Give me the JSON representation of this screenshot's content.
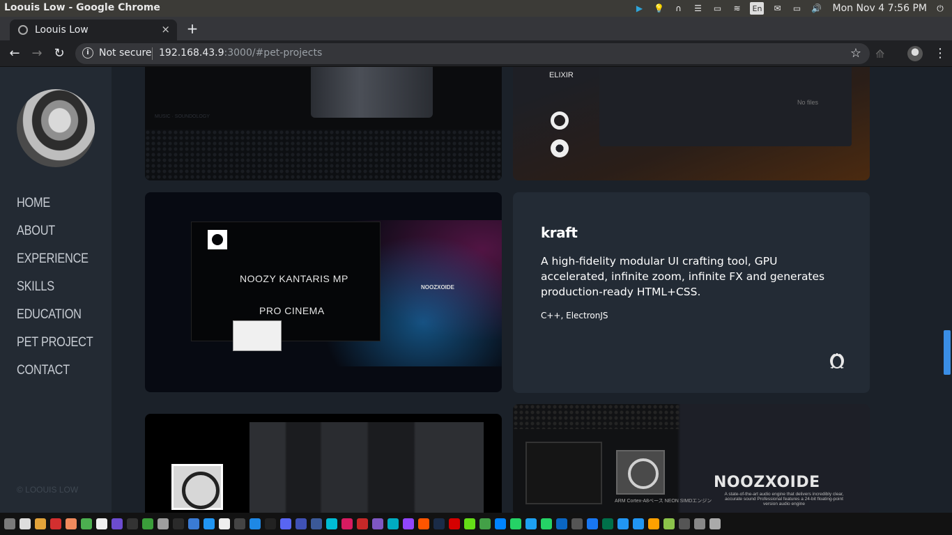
{
  "os": {
    "window_title": "Loouis Low - Google Chrome",
    "lang": "En",
    "clock": "Mon Nov  4  7:56 PM"
  },
  "browser": {
    "tab_title": "Loouis Low",
    "tab_close": "×",
    "new_tab": "+",
    "security": "Not secure",
    "url_host": "192.168.43.9",
    "url_path": ":3000/#pet-projects"
  },
  "sidebar": {
    "nav": [
      "HOME",
      "ABOUT",
      "EXPERIENCE",
      "SKILLS",
      "EDUCATION",
      "PET PROJECT",
      "CONTACT"
    ],
    "copyright": "© LOOUIS LOW"
  },
  "cards": {
    "music": {
      "caption": "MUSIC · SOUNDOLOGY"
    },
    "elixir": {
      "label": "ELIXIR",
      "status": "No files"
    },
    "noozy": {
      "title": "NOOZY KANTARIS MP",
      "subtitle": "PRO CINEMA",
      "brand": "NOOZXOIDE"
    },
    "kraft": {
      "title": "kraft",
      "description": "A high-fidelity modular UI crafting tool, GPU accelerated, infinite zoom, infinite FX and generates production-ready HTML+CSS.",
      "tech": "C++, ElectronJS",
      "platform_icon": "linux-tux-icon"
    },
    "noozxoide": {
      "brand": "NOOZXOIDE",
      "tagline": "A state-of-the-art audio engine that delivers incredibly clear, accurate sound Professional features a 24-bit floating-point version audio engine",
      "chip_label": "ARM Cortex-A8ベース NEON SIMDエンジン"
    }
  },
  "dock": {
    "icons": [
      "#7a7a7a",
      "#ddd",
      "#e2a33a",
      "#d32f2f",
      "#f08a5d",
      "#4caf50",
      "#eee",
      "#6c4ccf",
      "#333",
      "#3a9e3a",
      "#9e9e9e",
      "#2a2a2a",
      "#3a7bd5",
      "#2196f3",
      "#eee",
      "#444",
      "#1e88e5",
      "#222",
      "#5865f2",
      "#3f51b5",
      "#3b5998",
      "#00bcd4",
      "#d81b60",
      "#c62828",
      "#7e57c2",
      "#00acc1",
      "#9146ff",
      "#ff5500",
      "#1a2b47",
      "#d50000",
      "#64dd17",
      "#43a047",
      "#0084ff",
      "#25d366",
      "#1da1f2",
      "#25d366",
      "#0a66c2",
      "#555",
      "#1877f2",
      "#00704a",
      "#2196f3",
      "#2196f3",
      "#ffa000",
      "#8bc34a",
      "#555",
      "#888",
      "#aaa"
    ]
  }
}
